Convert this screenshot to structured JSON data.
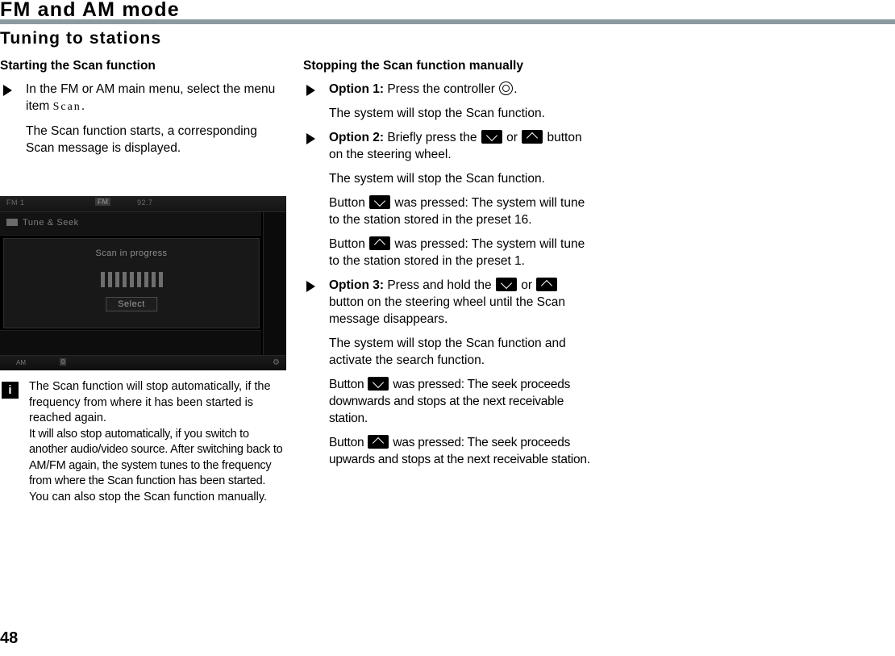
{
  "document": {
    "title": "FM and AM mode",
    "section_title": "Tuning to stations",
    "page_number": "48",
    "rule_color": "#8b9a9e"
  },
  "left_column": {
    "heading": "Starting the Scan function",
    "step": {
      "text_before": "In the FM or AM main menu, select the menu item ",
      "menu_item": "Scan",
      "text_after": "."
    },
    "result": "The Scan function starts, a corresponding Scan message is displayed."
  },
  "radio_screenshot": {
    "band_label": "FM 1",
    "source_label": "FM",
    "frequency": "92.7",
    "menu_item": "Tune & Seek",
    "dialog_message": "Scan in progress",
    "progress_bars": 9,
    "select_button": "Select",
    "status_left": "AM",
    "status_mid": "0",
    "status_right": "⚙"
  },
  "note": {
    "icon": "i",
    "paragraphs": [
      "The Scan function will stop automatically, if the frequency from where it has been started is reached again.",
      "It will also stop automatically, if you switch to another audio/video source. After switching back to AM/FM again, the system tunes to the frequency from where the Scan function has been started.",
      "You can also stop the Scan function manually."
    ]
  },
  "right_column": {
    "heading": "Stopping the Scan function manually",
    "option1": {
      "label": "Option 1:",
      "text_before": " Press the controller ",
      "text_after": "."
    },
    "option1_result": "The system will stop the Scan function.",
    "option2": {
      "label": "Option 2:",
      "text_before": " Briefly press the ",
      "text_middle": " or ",
      "text_after": " button on the steering wheel."
    },
    "option2_result": "The system will stop the Scan function.",
    "option2_down": {
      "prefix": "Button ",
      "suffix": " was pressed: The system will tune to the station stored in the preset 16."
    },
    "option2_up": {
      "prefix": "Button ",
      "suffix": " was pressed: The system will tune to the station stored in the preset 1."
    },
    "option3": {
      "label": "Option 3:",
      "text_before": " Press and hold the ",
      "text_middle": " or ",
      "text_after": " button on the steering wheel until the Scan message disappears."
    },
    "option3_result": "The system will stop the Scan function and activate the search function.",
    "option3_down": {
      "prefix": "Button ",
      "suffix": " was pressed: The seek proceeds downwards and stops at the next receivable station."
    },
    "option3_up": {
      "prefix": "Button ",
      "suffix": " was pressed: The seek proceeds upwards and stops at the next receivable station."
    }
  }
}
